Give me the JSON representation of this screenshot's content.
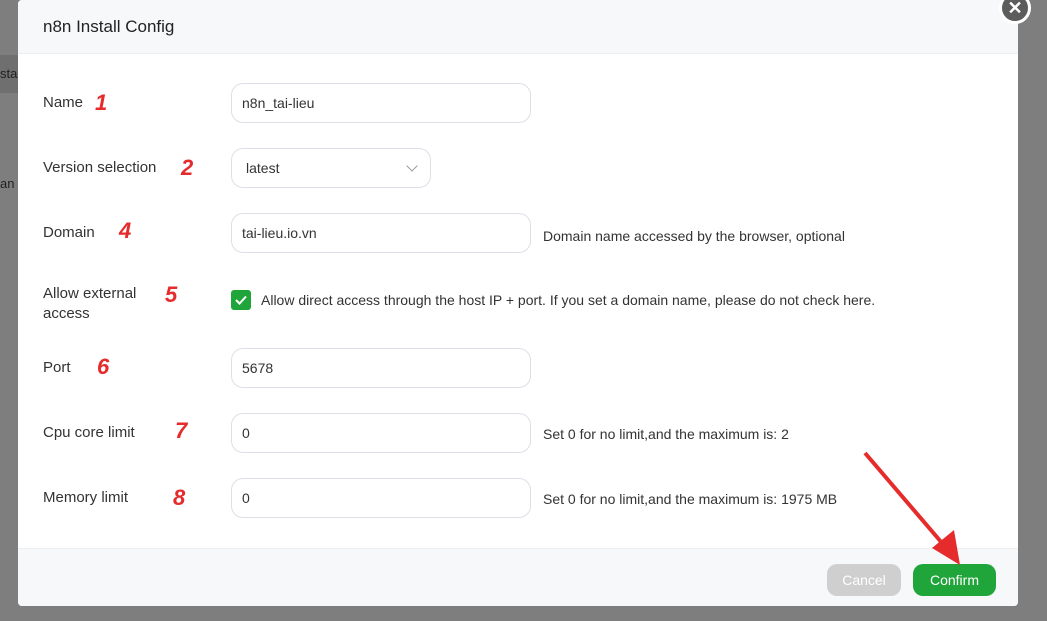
{
  "background": {
    "fragment_1": "sta",
    "fragment_2": "an"
  },
  "modal": {
    "title": "n8n Install Config",
    "close_icon": "close-icon"
  },
  "form": {
    "name": {
      "label": "Name",
      "marker": "1",
      "value": "n8n_tai-lieu"
    },
    "version": {
      "label": "Version selection",
      "marker": "2",
      "selected": "latest"
    },
    "domain": {
      "label": "Domain",
      "marker": "4",
      "value": "tai-lieu.io.vn",
      "hint": "Domain name accessed by the browser, optional"
    },
    "external": {
      "label_line1": "Allow external",
      "label_line2": "access",
      "marker": "5",
      "checked": true,
      "text": "Allow direct access through the host IP + port. If you set a domain name, please do not check here."
    },
    "port": {
      "label": "Port",
      "marker": "6",
      "value": "5678"
    },
    "cpu": {
      "label": "Cpu core limit",
      "marker": "7",
      "value": "0",
      "hint": "Set 0 for no limit,and the maximum is: 2"
    },
    "memory": {
      "label": "Memory limit",
      "marker": "8",
      "value": "0",
      "hint": "Set 0 for no limit,and the maximum is: 1975 MB"
    }
  },
  "footer": {
    "cancel_label": "Cancel",
    "confirm_label": "Confirm"
  },
  "colors": {
    "accent": "#20a53a",
    "annotation": "#e52b2b"
  }
}
